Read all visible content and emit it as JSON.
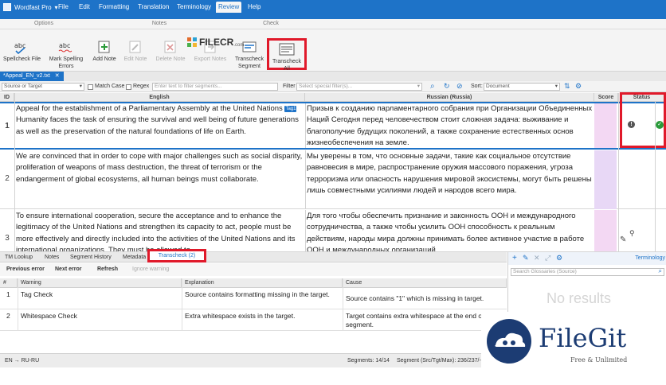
{
  "menu": {
    "app_name": "Wordfast Pro",
    "items": [
      "File",
      "Edit",
      "Formatting",
      "Translation",
      "Terminology",
      "Review",
      "Help"
    ],
    "active_index": 5
  },
  "ribbon": {
    "groups": {
      "options": "Options",
      "notes": "Notes",
      "check": "Check"
    },
    "spellcheck_file": "Spellcheck File",
    "mark_spelling_errors_1": "Mark Spelling",
    "mark_spelling_errors_2": "Errors",
    "add_note": "Add Note",
    "edit_note": "Edit Note",
    "delete_note": "Delete Note",
    "export_notes": "Export Notes",
    "transcheck_segment_1": "Transcheck",
    "transcheck_segment_2": "Segment",
    "transcheck_all_1": "Transcheck",
    "transcheck_all_2": "All",
    "watermark": "FILECR",
    "watermark_sub": ".com"
  },
  "document_tab": "*Appeal_EN_v2.txt",
  "filter": {
    "scope": "Source or Target",
    "match_case": "Match Case",
    "regex": "Regex",
    "text_placeholder": "Enter text to filter segments...",
    "filter_label": "Filter",
    "special_placeholder": "Select special filter(s)...",
    "sort_label": "Sort:",
    "sort_value": "Document"
  },
  "grid": {
    "headers": {
      "id": "ID",
      "source": "English",
      "target": "Russian (Russia)",
      "score": "Score",
      "status": "Status"
    },
    "rows": [
      {
        "id": "1",
        "source_a": "Appeal for the establishment of a Parliamentary Assembly at the United Nations",
        "tag": "Tag1",
        "source_b": "Humanity faces the task of ensuring the survival and well being of future generations as well as the preservation of the natural foundations of life on Earth.",
        "target": "Призыв к созданию парламентарного собрания при Организации Объединенных Наций Сегодня перед человечеством стоит сложная задача: выживание и благополучие будущих поколений, а также сохранение естественных основ жизнеобеспечения на земле."
      },
      {
        "id": "2",
        "source": "We are convinced that in order to cope with major challenges such as social disparity, proliferation of weapons of mass destruction, the threat of terrorism or the endangerment of global ecosystems, all human beings must collaborate.",
        "target": "Мы уверены в том, что основные задачи, такие как социальное отсутствие равновесия в мире, распространение оружия массового поражения, угроза терроризма или опасность нарушения мировой экосистемы, могут быть решены лишь совместными усилиями людей и народов всего мира."
      },
      {
        "id": "3",
        "source": "To ensure international cooperation, secure the acceptance and to enhance the legitimacy of the United Nations and strengthen its capacity to act, people must be more effectively and directly included into the activities of the United Nations and its international organizations. They must be allowed to",
        "target": "Для того чтобы обеспечить признание и законность ООН и международного сотрудничества, а также чтобы усилить ООН способность к реальным действиям, народы мира должны принимать более активное участие в работе ООН и международных организаций"
      }
    ]
  },
  "bottom": {
    "tabs": [
      "TM Lookup",
      "Notes",
      "Segment History",
      "Metadata",
      "Transcheck (2)"
    ],
    "active_tab": 4,
    "buttons": {
      "prev": "Previous error",
      "next": "Next error",
      "refresh": "Refresh",
      "ignore": "Ignore warning"
    },
    "columns": {
      "num": "#",
      "warning": "Warning",
      "explanation": "Explanation",
      "cause": "Cause"
    },
    "warnings": [
      {
        "num": "1",
        "warning": "Tag Check",
        "explanation": "Source contains formatting missing in the target.",
        "cause": "Source contains \"1\" which is missing in target."
      },
      {
        "num": "2",
        "warning": "Whitespace Check",
        "explanation": "Extra whitespace exists in the target.",
        "cause": "Target contains extra whitespace at the end of the segment."
      }
    ]
  },
  "right_panel": {
    "title": "Terminology",
    "search_placeholder": "Search Glossaries (Source)",
    "no_results": "No results"
  },
  "statusbar": {
    "lang": "EN → RU-RU",
    "segments": "Segments: 14/14",
    "segment_chars": "Segment (Src/Tgt/Max): 236/237/-"
  },
  "logo": {
    "name": "FileGit",
    "tagline": "Free & Unlimited"
  },
  "colors": {
    "accent": "#1e73c8",
    "highlight": "#e0192a"
  }
}
